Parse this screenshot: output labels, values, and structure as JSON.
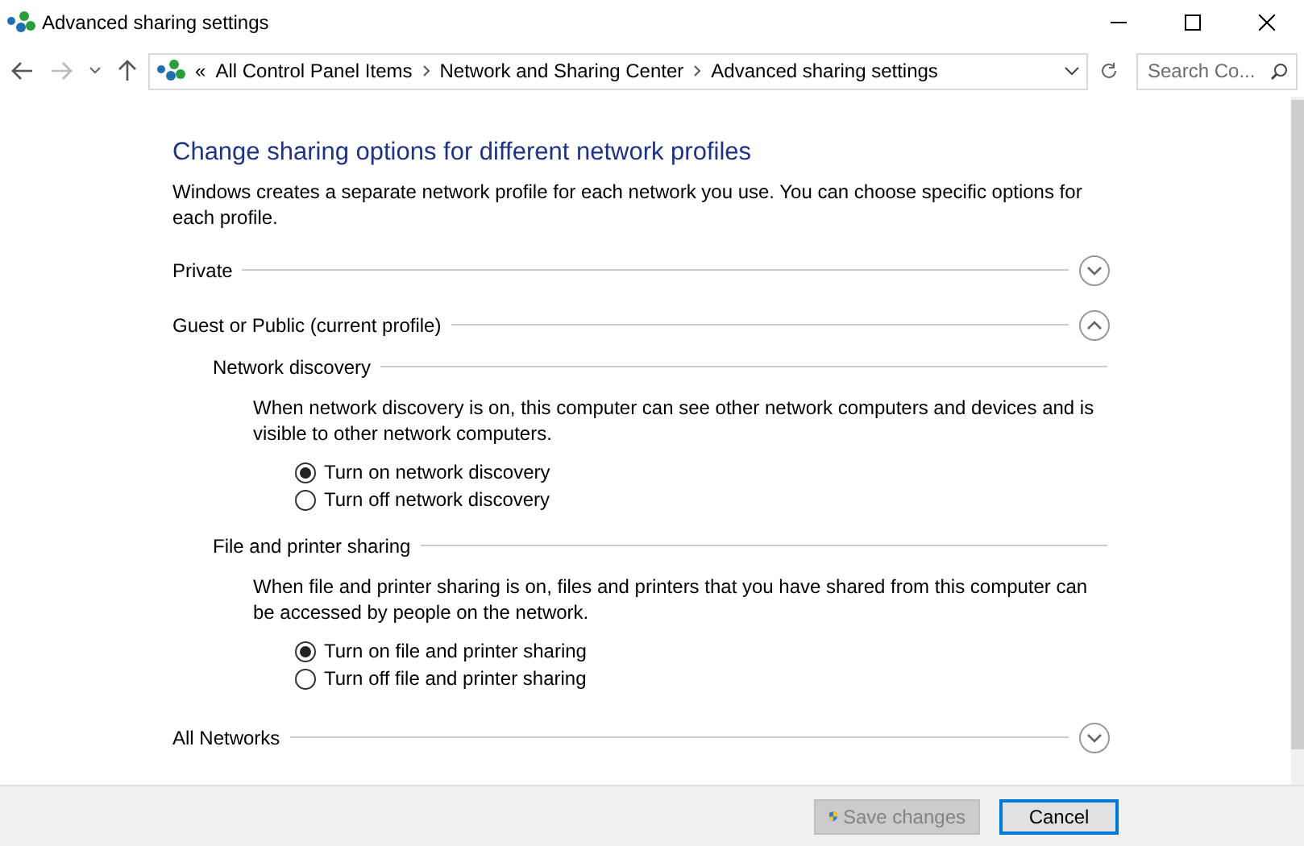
{
  "window": {
    "title": "Advanced sharing settings"
  },
  "address_bar": {
    "overflow": "«",
    "breadcrumbs": [
      "All Control Panel Items",
      "Network and Sharing Center",
      "Advanced sharing settings"
    ]
  },
  "search": {
    "placeholder": "Search Co..."
  },
  "heading": "Change sharing options for different network profiles",
  "description": "Windows creates a separate network profile for each network you use. You can choose specific options for each profile.",
  "profiles": [
    {
      "name": "Private",
      "expanded": false
    },
    {
      "name": "Guest or Public (current profile)",
      "expanded": true,
      "sections": [
        {
          "title": "Network discovery",
          "description": "When network discovery is on, this computer can see other network computers and devices and is visible to other network computers.",
          "options": [
            {
              "label": "Turn on network discovery",
              "selected": true
            },
            {
              "label": "Turn off network discovery",
              "selected": false
            }
          ]
        },
        {
          "title": "File and printer sharing",
          "description": "When file and printer sharing is on, files and printers that you have shared from this computer can be accessed by people on the network.",
          "options": [
            {
              "label": "Turn on file and printer sharing",
              "selected": true
            },
            {
              "label": "Turn off file and printer sharing",
              "selected": false
            }
          ]
        }
      ]
    },
    {
      "name": "All Networks",
      "expanded": false
    }
  ],
  "buttons": [
    {
      "label": "Save changes",
      "kind": "shield",
      "disabled": true
    },
    {
      "label": "Cancel",
      "kind": "plain",
      "disabled": false
    }
  ]
}
